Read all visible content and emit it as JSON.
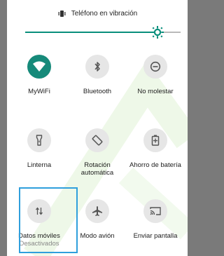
{
  "status": {
    "text": "Teléfono en vibración",
    "icon": "vibrate-icon"
  },
  "brightness": {
    "level": 0.85
  },
  "tiles": [
    {
      "key": "wifi",
      "label": "MyWiFi",
      "icon": "wifi-icon",
      "active": true
    },
    {
      "key": "bluetooth",
      "label": "Bluetooth",
      "icon": "bluetooth-icon",
      "active": false
    },
    {
      "key": "dnd",
      "label": "No molestar",
      "icon": "do-not-disturb-icon",
      "active": false
    },
    {
      "key": "flashlight",
      "label": "Linterna",
      "icon": "flashlight-icon",
      "active": false
    },
    {
      "key": "rotation",
      "label": "Rotación automática",
      "icon": "auto-rotate-icon",
      "active": false
    },
    {
      "key": "battery",
      "label": "Ahorro de batería",
      "icon": "battery-saver-icon",
      "active": false
    },
    {
      "key": "mobile_data",
      "label": "Datos móviles",
      "sublabel": "Desactivados",
      "icon": "mobile-data-icon",
      "active": false
    },
    {
      "key": "airplane",
      "label": "Modo avión",
      "icon": "airplane-icon",
      "active": false
    },
    {
      "key": "cast",
      "label": "Enviar pantalla",
      "icon": "cast-icon",
      "active": false
    }
  ],
  "colors": {
    "accent": "#168a7a",
    "highlight": "#2f9fdc",
    "tile_off": "#e6e6e6",
    "icon_off": "#555555"
  }
}
